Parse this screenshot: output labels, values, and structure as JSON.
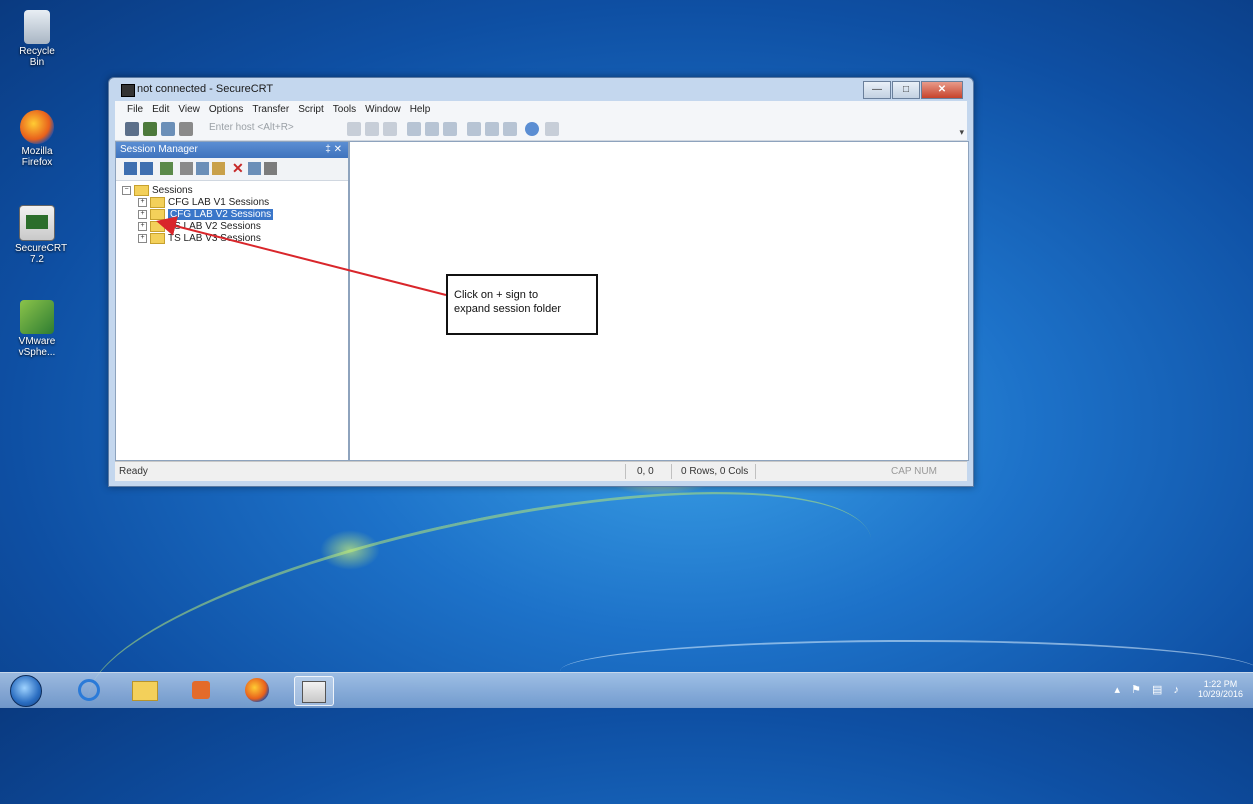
{
  "desktop": {
    "icons": [
      {
        "label": "Recycle Bin",
        "icon": "recycle-bin-icon"
      },
      {
        "label": "Mozilla Firefox",
        "icon": "firefox-icon"
      },
      {
        "label": "SecureCRT 7.2",
        "icon": "securecrt-icon"
      },
      {
        "label": "VMware vSphe...",
        "icon": "vmware-icon"
      }
    ]
  },
  "window": {
    "title": "not connected - SecureCRT",
    "controls": {
      "minimize": "—",
      "maximize": "□",
      "close": "✕"
    },
    "menu": [
      "File",
      "Edit",
      "View",
      "Options",
      "Transfer",
      "Script",
      "Tools",
      "Window",
      "Help"
    ],
    "toolbar": {
      "host_placeholder": "Enter host <Alt+R>"
    },
    "session_manager": {
      "title": "Session Manager",
      "pin": "‡ ✕",
      "tree": {
        "root": "Sessions",
        "items": [
          {
            "label": "CFG LAB V1 Sessions",
            "selected": false
          },
          {
            "label": "CFG LAB V2 Sessions",
            "selected": true
          },
          {
            "label": "TS LAB V2 Sessions",
            "selected": false
          },
          {
            "label": "TS LAB V3 Sessions",
            "selected": false
          }
        ]
      }
    },
    "status": {
      "text": "Ready",
      "cursor": "0, 0",
      "size": "0 Rows, 0 Cols",
      "keys": "CAP NUM"
    }
  },
  "annotation": {
    "line1": "Click on + sign to",
    "line2": "expand session folder",
    "arrow_color": "#d9262b"
  },
  "taskbar": {
    "clock_time": "1:22 PM",
    "clock_date": "10/29/2016"
  }
}
